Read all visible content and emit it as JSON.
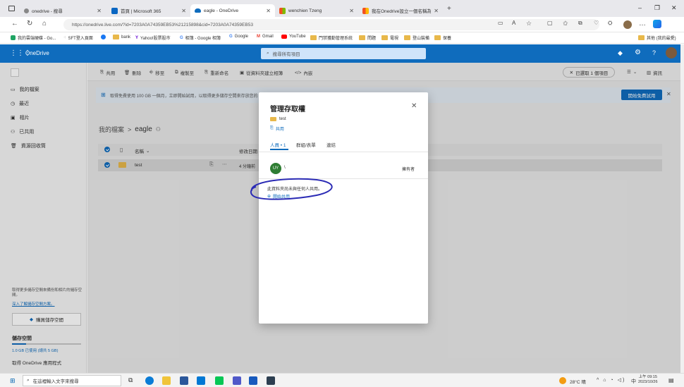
{
  "browser": {
    "tabs": [
      {
        "label": "onedrive - 搜尋"
      },
      {
        "label": "首頁 | Microsoft 365"
      },
      {
        "label": "eagle - OneDrive"
      },
      {
        "label": "wenchien Tzeng"
      },
      {
        "label": "我在Onedrive設立一個名稱為eagle..."
      }
    ],
    "url": "https://onedrive.live.com/?id=7203A0A74359EB53%21215898&cid=7203A0A74359EB53",
    "bookmarks": [
      "我的雲端硬碟 - Go...",
      "SFT登入頁面",
      "bank",
      "Yahoo!股票股市",
      "相簿 - Google 相簿",
      "Google",
      "Gmail",
      "YouTube",
      "門禁獲勤管理系統",
      "問題",
      "電視",
      "登山裝備",
      "保養"
    ],
    "bookmarks_other": "其他 (我的最愛)"
  },
  "onedrive": {
    "brand": "OneDrive",
    "search_placeholder": "搜尋所有項目",
    "sidebar": {
      "items": [
        "我的檔案",
        "最近",
        "相片",
        "已共用",
        "資源回收筒"
      ],
      "storage_promo": "取得更多儲存空間來備份和相片的儲存空間。",
      "storage_link": "深入了解儲存空間方案。",
      "buy_storage": "購買儲存空間",
      "storage_title": "儲存空間",
      "storage_used": "1.0 GB 已使用 (總共 5 GB)",
      "get_apps": "取得 OneDrive 應用程式",
      "storage_fraction": 0.2
    },
    "toolbar": {
      "share": "共用",
      "delete": "刪除",
      "move_to": "移至",
      "copy_to": "複製至",
      "rename": "重新命名",
      "create_album": "從資料夾建立相簿",
      "embed": "內嵌",
      "selected": "已選取 1 個項目",
      "info": "資訊"
    },
    "banner": {
      "text": "取得免費使用 100 GB 一個月，立即開始試用，以取得更多儲存空間來存放您的檔案和相片。",
      "button": "開始免費試用"
    },
    "breadcrumb": {
      "root": "我的檔案",
      "sep": ">",
      "current": "eagle"
    },
    "columns": {
      "name": "名稱",
      "modified": "修改日期"
    },
    "rows": [
      {
        "name": "test",
        "modified": "4 分鐘前"
      }
    ]
  },
  "dialog": {
    "title": "管理存取權",
    "item_name": "test",
    "share_link": "共用",
    "tabs": [
      "人員 • 1",
      "群組/表單",
      "連結"
    ],
    "owner_initials": "UY",
    "owner_name": "\\",
    "owner_role": "擁有者",
    "not_shared": "此資料夾尚未與任何人共用。",
    "start_sharing": "開始共用"
  },
  "taskbar": {
    "search_placeholder": "在這裡輸入文字來搜尋",
    "weather": "28°C 晴",
    "lang": "中",
    "time": "上午 09:15",
    "date": "2023/10/26"
  }
}
